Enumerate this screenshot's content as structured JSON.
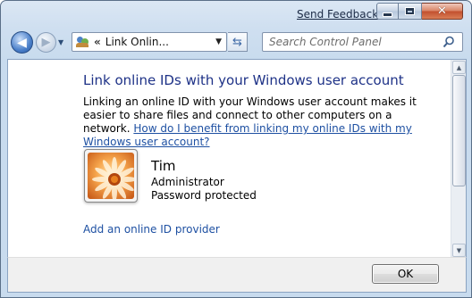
{
  "window": {
    "send_feedback": "Send Feedback"
  },
  "nav": {
    "address_prefix": "«",
    "address_text": "Link Onlin...",
    "search_placeholder": "Search Control Panel"
  },
  "content": {
    "title": "Link online IDs with your Windows user account",
    "description": "Linking an online ID with your Windows user account makes it easier to share files and connect to other computers on a network.",
    "help_link": "How do I benefit from linking my online IDs with my Windows user account?",
    "user": {
      "name": "Tim",
      "role": "Administrator",
      "password_status": "Password protected"
    },
    "add_provider_link": "Add an online ID provider"
  },
  "footer": {
    "ok_label": "OK"
  },
  "colors": {
    "title_blue": "#1e3287",
    "link_blue": "#1e50a2",
    "close_red": "#c24f2e"
  },
  "icons": [
    "back-arrow-icon",
    "forward-arrow-icon",
    "user-accounts-icon",
    "refresh-icon",
    "search-icon",
    "flower-avatar"
  ]
}
